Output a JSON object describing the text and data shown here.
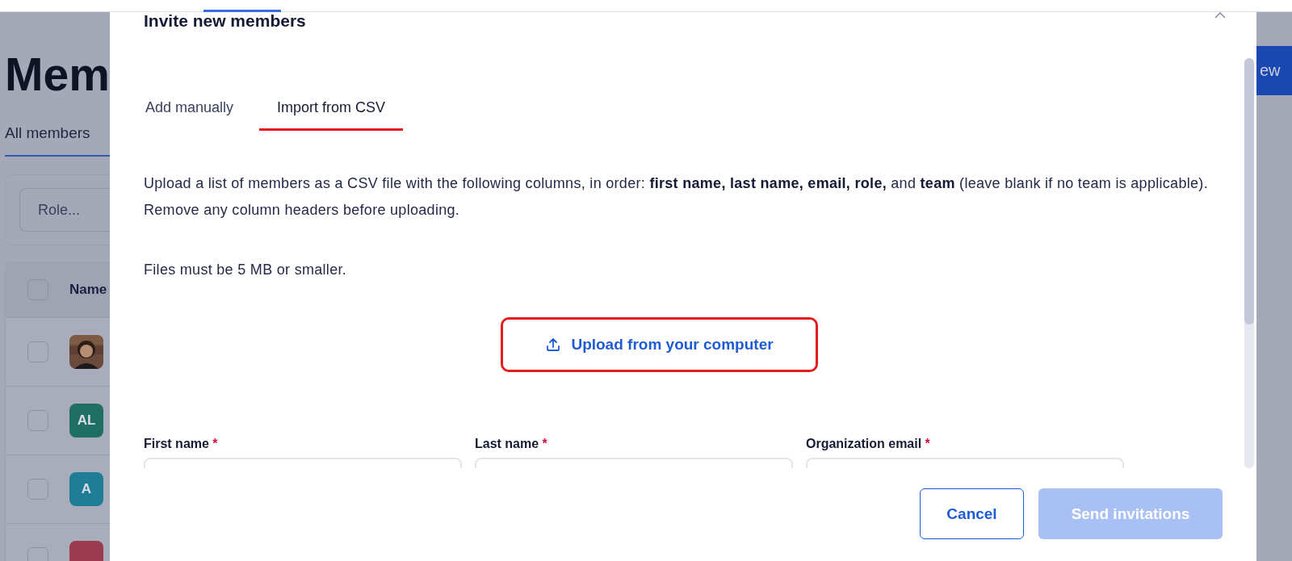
{
  "background": {
    "heading": "Mem",
    "tab": "All members",
    "filter": {
      "placeholder": "Role..."
    },
    "table": {
      "header": {
        "label": "Name",
        "checked": false
      },
      "rows": [
        {
          "checked": false
        },
        {
          "checked": false,
          "avatar": {
            "kind": "initials",
            "text": "AL",
            "color": "#1f6f63"
          }
        },
        {
          "checked": false,
          "avatar": {
            "kind": "initials",
            "text": "A",
            "color": "#1f7d97"
          }
        },
        {
          "checked": false,
          "avatar": {
            "kind": "blank",
            "color": "#9a3b52"
          }
        }
      ]
    },
    "new_button": "ew"
  },
  "dialog": {
    "title": "Invite new members",
    "tabs": [
      {
        "label": "Add manually",
        "selected": false
      },
      {
        "label": "Import from CSV",
        "selected": true
      }
    ],
    "instructions": "Upload a list of members as a CSV file with the following columns, in order: **first name, last name, email, role,** and **team** (leave blank if no team is applicable). Remove any column headers before uploading.",
    "size_note": "Files must be 5 MB or smaller.",
    "upload_button": "Upload from your computer",
    "fields": [
      {
        "label": "First name",
        "required_mark": "*"
      },
      {
        "label": "Last name",
        "required_mark": "*"
      },
      {
        "label": "Organization email",
        "required_mark": "*"
      }
    ],
    "buttons": [
      {
        "label": "Cancel",
        "kind": "secondary",
        "disabled": false
      },
      {
        "label": "Send invitations",
        "kind": "primary",
        "disabled": true
      }
    ]
  }
}
